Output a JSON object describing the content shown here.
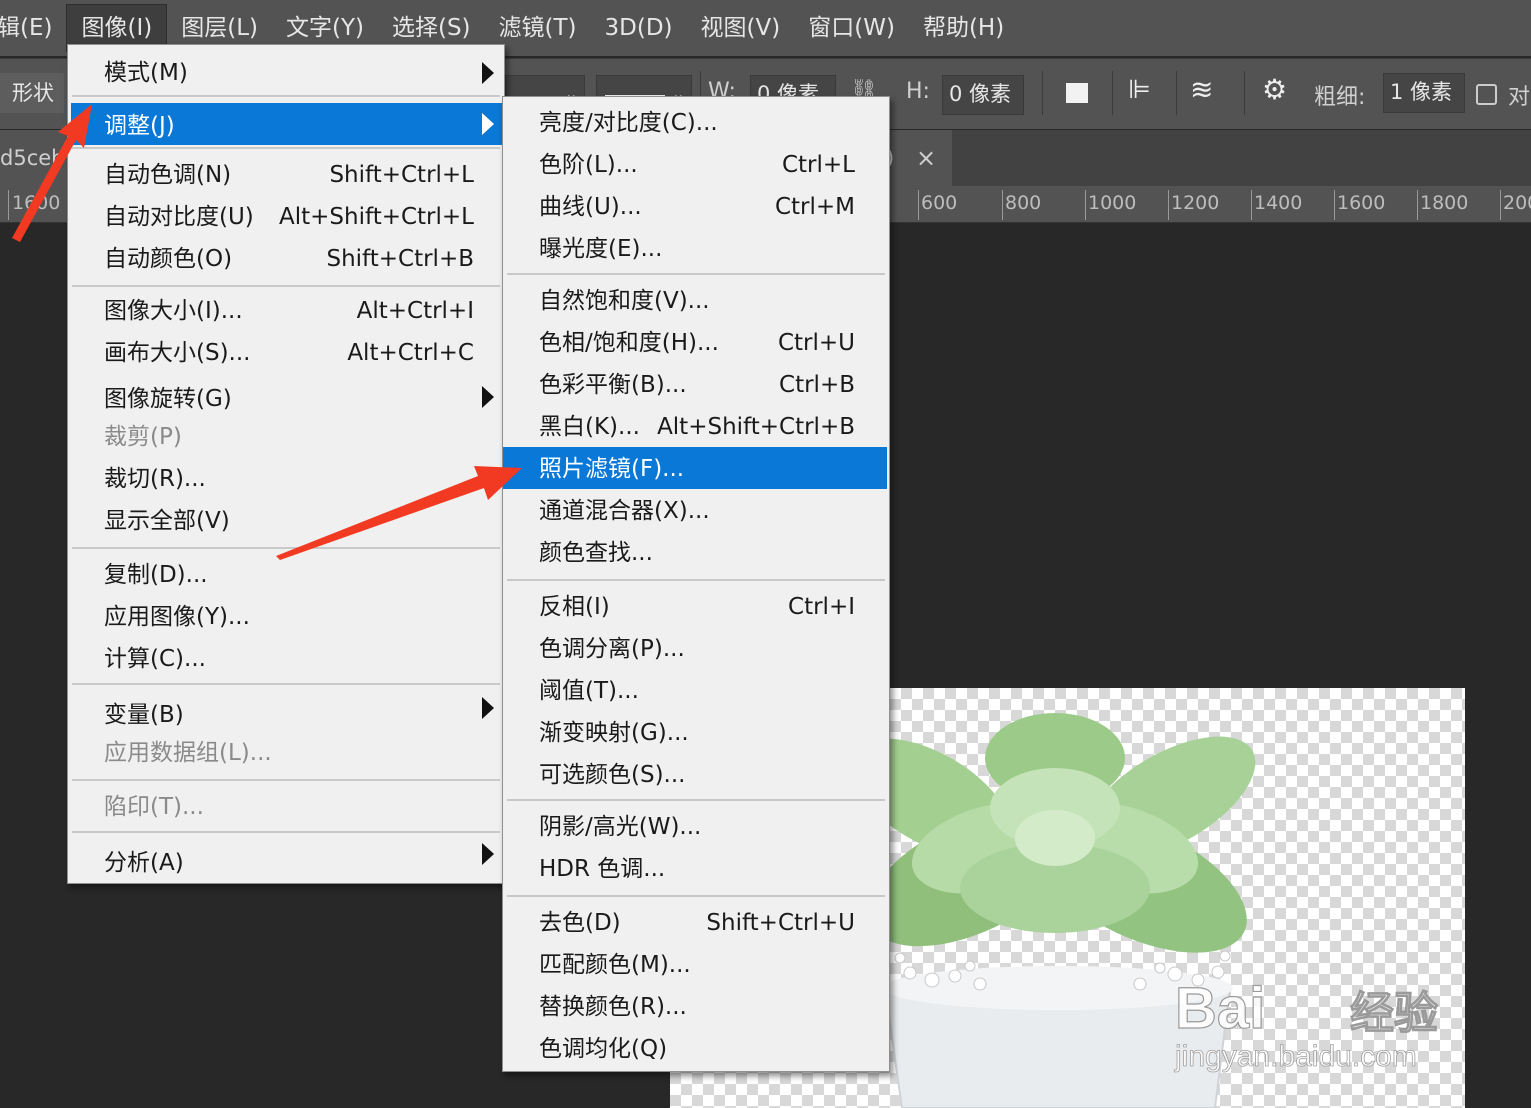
{
  "menubar": {
    "items": [
      "辑(E)",
      "图像(I)",
      "图层(L)",
      "文字(Y)",
      "选择(S)",
      "滤镜(T)",
      "3D(D)",
      "视图(V)",
      "窗口(W)",
      "帮助(H)"
    ]
  },
  "options": {
    "shape_mode": "形状",
    "w_label": "W:",
    "w_value": "0 像素",
    "h_label": "H:",
    "h_value": "0 像素",
    "stroke_label": "粗细:",
    "stroke_value": "1 像素",
    "align_label": "对"
  },
  "document_tab": {
    "name_fragment": "d5ceb",
    "suffix_fragment": ")",
    "close_glyph": "×"
  },
  "ruler": {
    "left_label": "1600",
    "labels": [
      "600",
      "800",
      "1000",
      "1200",
      "1400",
      "1600",
      "1800",
      "200"
    ]
  },
  "image_menu": {
    "items": [
      {
        "label": "模式(M)",
        "submenu": true
      },
      {
        "label": "调整(J)",
        "submenu": true,
        "highlighted": true
      },
      {
        "label": "自动色调(N)",
        "shortcut": "Shift+Ctrl+L"
      },
      {
        "label": "自动对比度(U)",
        "shortcut": "Alt+Shift+Ctrl+L"
      },
      {
        "label": "自动颜色(O)",
        "shortcut": "Shift+Ctrl+B"
      },
      {
        "label": "图像大小(I)...",
        "shortcut": "Alt+Ctrl+I"
      },
      {
        "label": "画布大小(S)...",
        "shortcut": "Alt+Ctrl+C"
      },
      {
        "label": "图像旋转(G)",
        "submenu": true
      },
      {
        "label": "裁剪(P)",
        "disabled": true
      },
      {
        "label": "裁切(R)..."
      },
      {
        "label": "显示全部(V)"
      },
      {
        "label": "复制(D)..."
      },
      {
        "label": "应用图像(Y)..."
      },
      {
        "label": "计算(C)..."
      },
      {
        "label": "变量(B)",
        "submenu": true
      },
      {
        "label": "应用数据组(L)...",
        "disabled": true
      },
      {
        "label": "陷印(T)...",
        "disabled": true
      },
      {
        "label": "分析(A)",
        "submenu": true
      }
    ]
  },
  "adjust_menu": {
    "items": [
      {
        "label": "亮度/对比度(C)..."
      },
      {
        "label": "色阶(L)...",
        "shortcut": "Ctrl+L"
      },
      {
        "label": "曲线(U)...",
        "shortcut": "Ctrl+M"
      },
      {
        "label": "曝光度(E)..."
      },
      {
        "label": "自然饱和度(V)..."
      },
      {
        "label": "色相/饱和度(H)...",
        "shortcut": "Ctrl+U"
      },
      {
        "label": "色彩平衡(B)...",
        "shortcut": "Ctrl+B"
      },
      {
        "label": "黑白(K)...",
        "shortcut": "Alt+Shift+Ctrl+B"
      },
      {
        "label": "照片滤镜(F)...",
        "highlighted": true
      },
      {
        "label": "通道混合器(X)..."
      },
      {
        "label": "颜色查找..."
      },
      {
        "label": "反相(I)",
        "shortcut": "Ctrl+I"
      },
      {
        "label": "色调分离(P)..."
      },
      {
        "label": "阈值(T)..."
      },
      {
        "label": "渐变映射(G)..."
      },
      {
        "label": "可选颜色(S)..."
      },
      {
        "label": "阴影/高光(W)..."
      },
      {
        "label": "HDR 色调..."
      },
      {
        "label": "去色(D)",
        "shortcut": "Shift+Ctrl+U"
      },
      {
        "label": "匹配颜色(M)..."
      },
      {
        "label": "替换颜色(R)..."
      },
      {
        "label": "色调均化(Q)"
      }
    ]
  },
  "watermark": {
    "brand": "Bai",
    "brand_cn": "经验",
    "url": "jingyan.baidu.com"
  },
  "colors": {
    "highlight": "#0a78d7",
    "arrow": "#f23a22",
    "menubar_bg": "#535353",
    "workspace_bg": "#282828"
  }
}
